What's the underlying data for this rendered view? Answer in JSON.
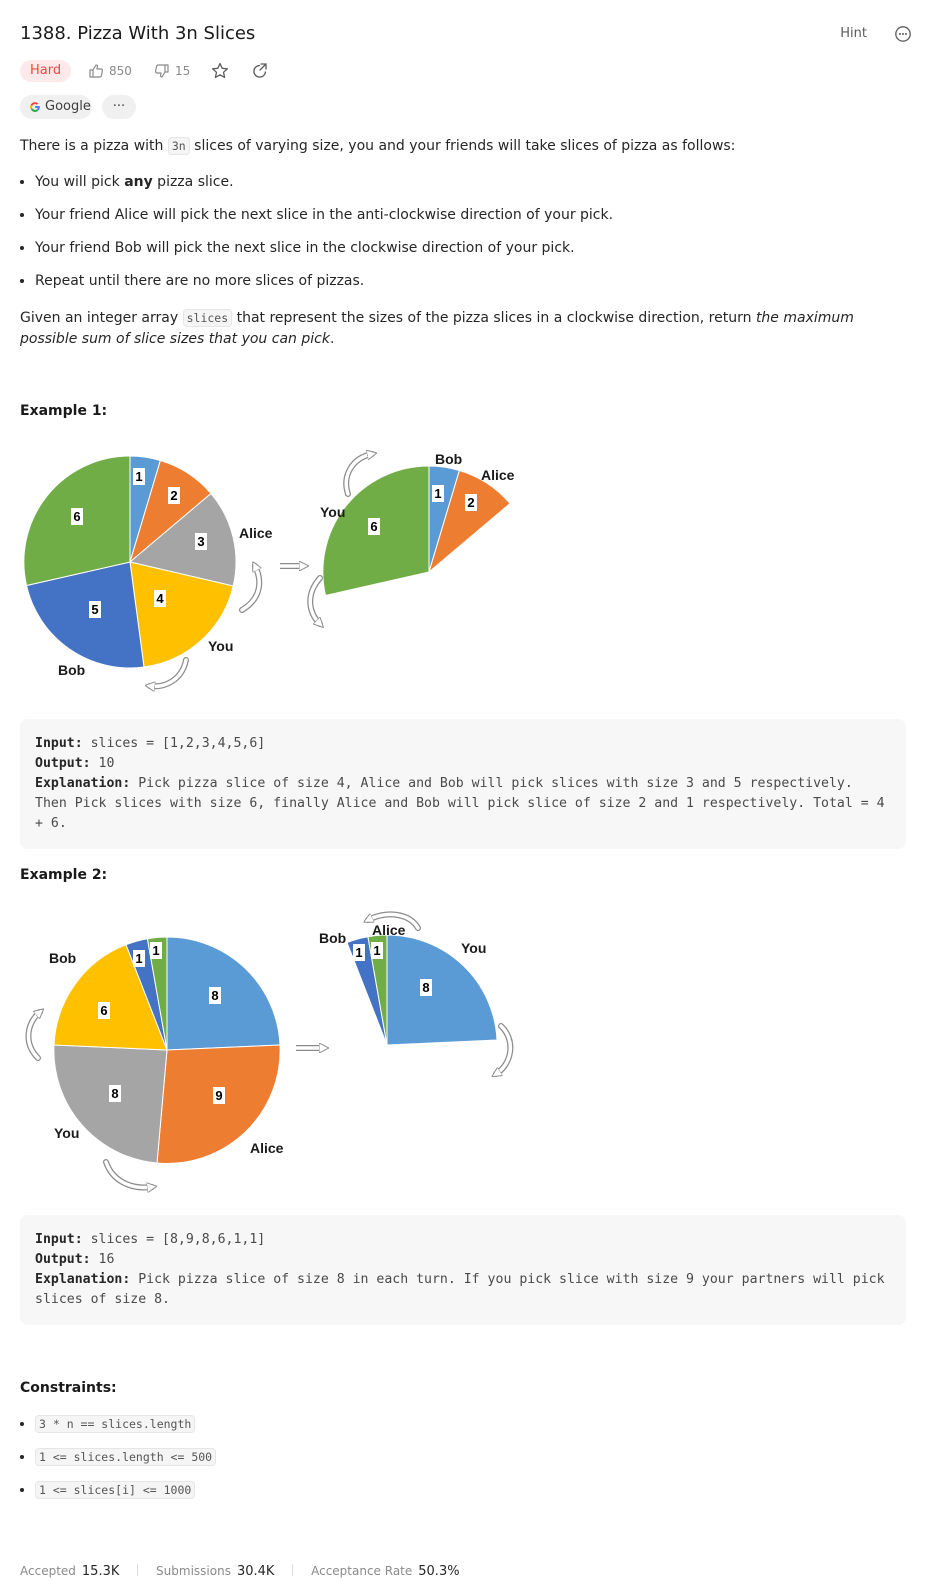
{
  "problem": {
    "title": "1388. Pizza With 3n Slices",
    "hint_label": "Hint",
    "difficulty": "Hard",
    "likes": "850",
    "dislikes": "15",
    "company_tag": "Google",
    "more_tags": "···"
  },
  "description": {
    "intro_pre": "There is a pizza with ",
    "intro_code": "3n",
    "intro_post": " slices of varying size, you and your friends will take slices of pizza as follows:",
    "rules": [
      {
        "pre": "You will pick ",
        "bold": "any",
        "post": " pizza slice."
      },
      {
        "text": "Your friend Alice will pick the next slice in the anti-clockwise direction of your pick."
      },
      {
        "text": "Your friend Bob will pick the next slice in the clockwise direction of your pick."
      },
      {
        "text": "Repeat until there are no more slices of pizzas."
      }
    ],
    "given_pre": "Given an integer array ",
    "given_code": "slices",
    "given_mid": " that represent the sizes of the pizza slices in a clockwise direction, return ",
    "given_italic": "the maximum possible sum of slice sizes that you can pick",
    "given_end": "."
  },
  "examples": [
    {
      "heading": "Example 1:",
      "input_label": "Input:",
      "input_value": " slices = [1,2,3,4,5,6]",
      "output_label": "Output:",
      "output_value": " 10",
      "explanation_label": "Explanation:",
      "explanation_value": " Pick pizza slice of size 4, Alice and Bob will pick slices with size 3 and 5 respectively. Then Pick slices with size 6, finally Alice and Bob will pick slice of size 2 and 1 respectively. Total = 4 + 6."
    },
    {
      "heading": "Example 2:",
      "input_label": "Input:",
      "input_value": " slices = [8,9,8,6,1,1]",
      "output_label": "Output:",
      "output_value": " 16",
      "explanation_label": "Explanation:",
      "explanation_value": " Pick pizza slice of size 8 in each turn. If you pick slice with size 9 your partners will pick slices of size 8."
    }
  ],
  "figures": {
    "ex1_left": {
      "slices": [
        "1",
        "2",
        "3",
        "4",
        "5",
        "6"
      ],
      "alice": "Alice",
      "you": "You",
      "bob": "Bob"
    },
    "ex1_right": {
      "slices": [
        "1",
        "2",
        "6"
      ],
      "bob": "Bob",
      "alice": "Alice",
      "you": "You"
    },
    "ex2_left": {
      "slices": [
        "8",
        "9",
        "8",
        "6",
        "1",
        "1"
      ],
      "bob": "Bob",
      "you": "You",
      "alice": "Alice"
    },
    "ex2_right": {
      "slices": [
        "1",
        "1",
        "8"
      ],
      "bob": "Bob",
      "alice": "Alice",
      "you": "You"
    },
    "colors": {
      "blue": "#5b9bd5",
      "orange": "#ed7d31",
      "gray": "#a5a5a5",
      "yellow": "#ffc000",
      "darkblue": "#4472c4",
      "green": "#70ad47"
    }
  },
  "constraints": {
    "heading": "Constraints:",
    "items": [
      "3 * n == slices.length",
      "1 <= slices.length <= 500",
      "1 <= slices[i] <= 1000"
    ]
  },
  "stats": {
    "accepted_label": "Accepted",
    "accepted_value": "15.3K",
    "submissions_label": "Submissions",
    "submissions_value": "30.4K",
    "rate_label": "Acceptance Rate",
    "rate_value": "50.3%"
  }
}
